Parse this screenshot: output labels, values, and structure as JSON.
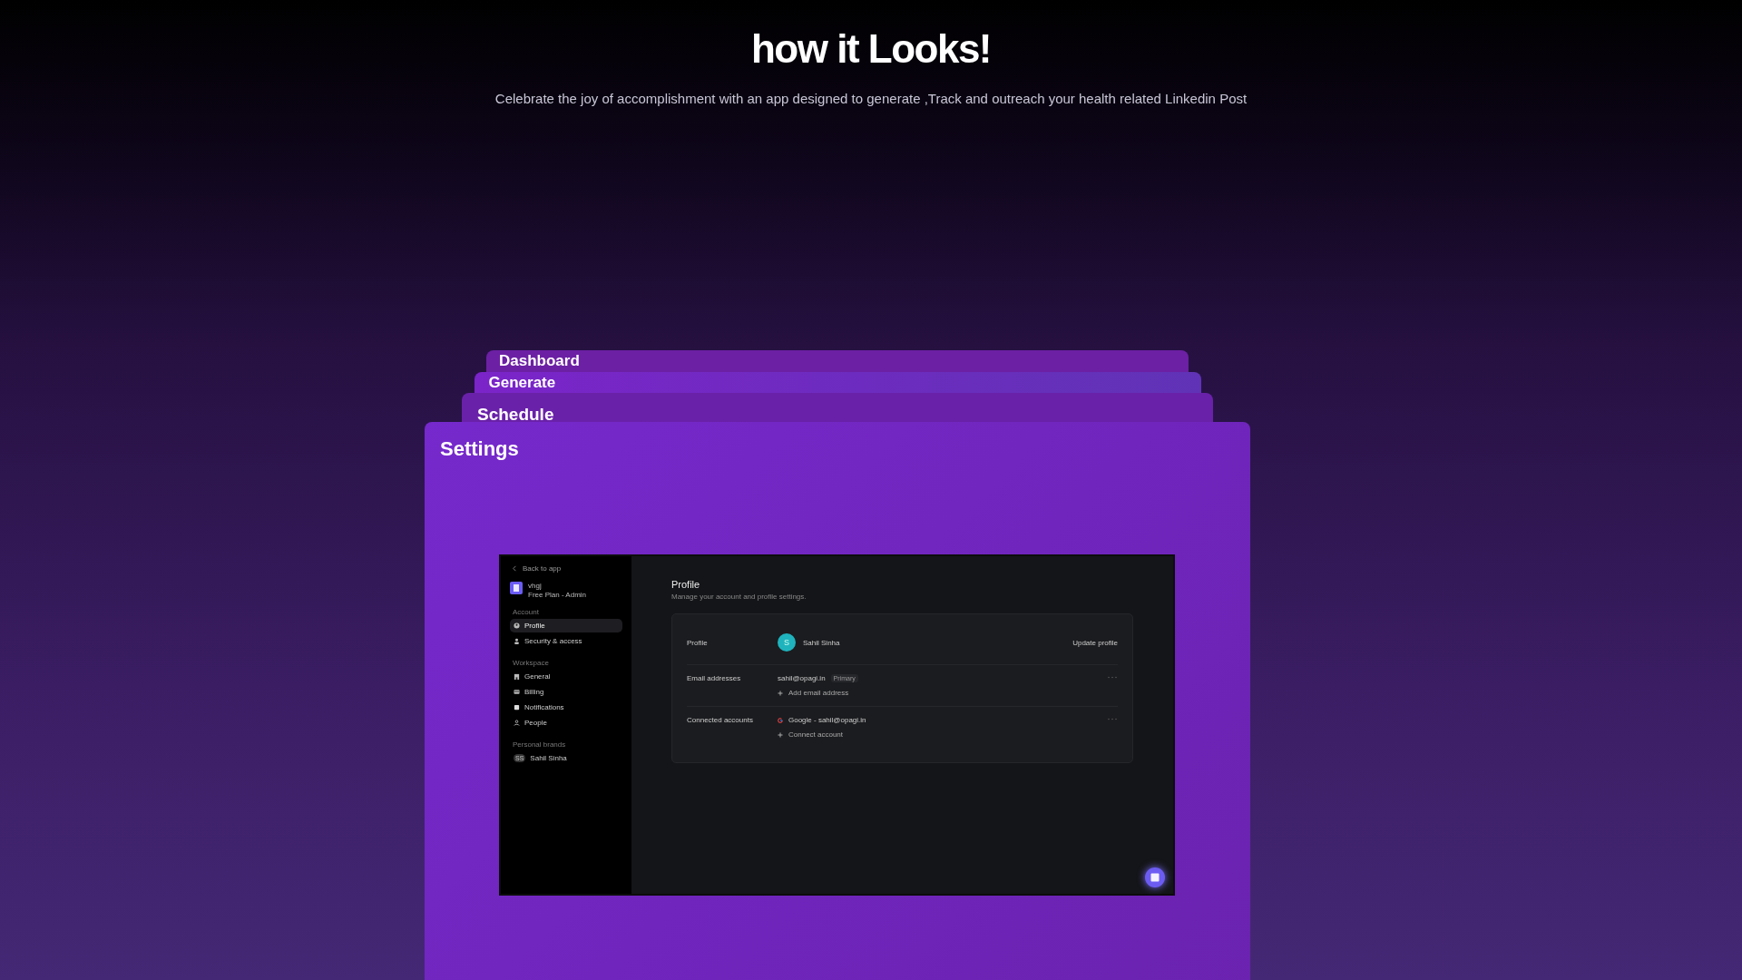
{
  "header": {
    "title": "how it Looks!",
    "subtitle": "Celebrate the joy of accomplishment with an app designed to generate ,Track and outreach your health related Linkedin Post"
  },
  "cards": [
    {
      "title": "Dashboard"
    },
    {
      "title": "Generate"
    },
    {
      "title": "Schedule"
    },
    {
      "title": "Settings"
    }
  ],
  "app": {
    "back_link": "Back to app",
    "workspace": {
      "name": "vhgj",
      "plan": "Free Plan - Admin"
    },
    "sidebar": [
      {
        "heading": "Account",
        "items": [
          {
            "label": "Profile",
            "selected": true
          },
          {
            "label": "Security & access",
            "selected": false
          }
        ]
      },
      {
        "heading": "Workspace",
        "items": [
          {
            "label": "General",
            "selected": false
          },
          {
            "label": "Billing",
            "selected": false
          },
          {
            "label": "Notifications",
            "selected": false
          },
          {
            "label": "People",
            "selected": false
          }
        ]
      },
      {
        "heading": "Personal brands",
        "items": [
          {
            "label": "Sahil Sinha",
            "badge": "SS",
            "selected": false
          }
        ]
      }
    ],
    "page": {
      "title": "Profile",
      "subtitle": "Manage your account and profile settings."
    },
    "profile_row": {
      "label": "Profile",
      "avatar_letter": "S",
      "name": "Sahil Sinha",
      "action": "Update profile"
    },
    "email_row": {
      "label": "Email addresses",
      "email": "sahil@opagi.in",
      "badge": "Primary",
      "add_action": "Add email address"
    },
    "accounts_row": {
      "label": "Connected accounts",
      "account": "Google - sahil@opagi.in",
      "connect_action": "Connect account"
    }
  }
}
